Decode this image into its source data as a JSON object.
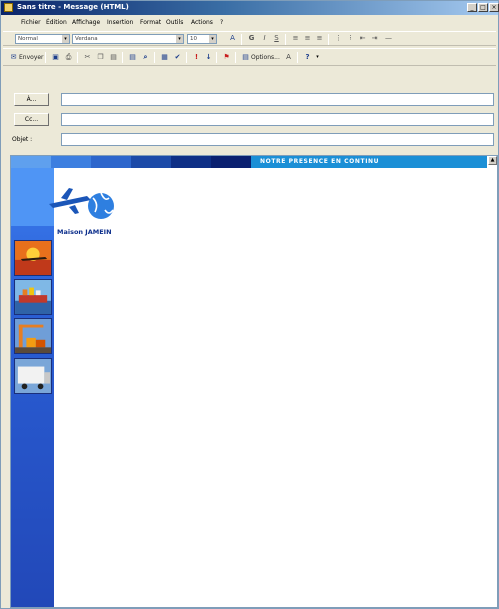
{
  "window": {
    "title": "Sans titre - Message (HTML)",
    "controls": {
      "minimize": "_",
      "maximize": "□",
      "close": "×"
    }
  },
  "menu": [
    "Fichier",
    "Édition",
    "Affichage",
    "Insertion",
    "Format",
    "Outils",
    "Actions",
    "?"
  ],
  "format_toolbar": {
    "style_value": "Normal",
    "font_value": "Verdana",
    "size_value": "10"
  },
  "standard_toolbar": {
    "send_label": "Envoyer",
    "options_label": "Options..."
  },
  "address": {
    "to_label": "À...",
    "cc_label": "Cc...",
    "subject_label": "Objet :",
    "to_value": "",
    "cc_value": "",
    "subject_value": ""
  },
  "message": {
    "banner_text": "NOTRE PRESENCE EN CONTINU",
    "logo_text": "Maison JAMEIN",
    "colors": {
      "banner": "#1b8fd6",
      "sidebar": "#2a5fd6",
      "stripe": [
        "#5fa0ee",
        "#3d7fe0",
        "#2d66cc",
        "#1c4aa8",
        "#0e2f86",
        "#0a2070"
      ]
    },
    "photos": [
      "airplane-photo",
      "ship-photo",
      "container-crane-photo",
      "truck-photo"
    ]
  }
}
